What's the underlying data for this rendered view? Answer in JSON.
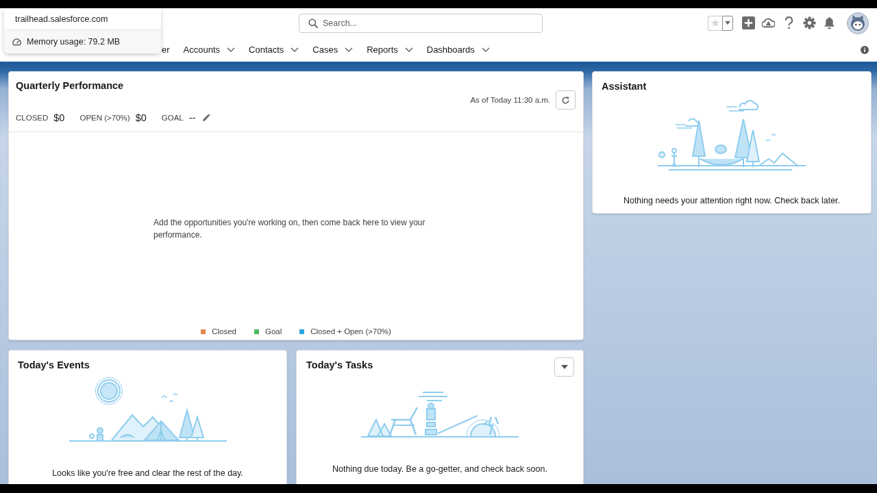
{
  "tooltip": {
    "site": "trailhead.salesforce.com",
    "memory": "Memory usage: 79.2 MB"
  },
  "header": {
    "search": {
      "placeholder": "Search..."
    }
  },
  "nav": {
    "items": [
      {
        "label": "er",
        "menu": false
      },
      {
        "label": "Accounts",
        "menu": true
      },
      {
        "label": "Contacts",
        "menu": true
      },
      {
        "label": "Cases",
        "menu": true
      },
      {
        "label": "Reports",
        "menu": true
      },
      {
        "label": "Dashboards",
        "menu": true
      }
    ]
  },
  "quarterly_performance": {
    "title": "Quarterly Performance",
    "as_of": "As of Today 11:30 a.m.",
    "metrics": [
      {
        "label": "CLOSED",
        "value": "$0",
        "editable": false
      },
      {
        "label": "OPEN (>70%)",
        "value": "$0",
        "editable": false
      },
      {
        "label": "GOAL",
        "value": "--",
        "editable": true
      }
    ],
    "message": "Add the opportunities you're working on, then come back here to view your performance.",
    "legend": [
      {
        "label": "Closed",
        "color": "#e8874a"
      },
      {
        "label": "Goal",
        "color": "#4cbb5c"
      },
      {
        "label": "Closed + Open (>70%)",
        "color": "#2aa6dd"
      }
    ]
  },
  "assistant": {
    "title": "Assistant",
    "message": "Nothing needs your attention right now. Check back later."
  },
  "events": {
    "title": "Today's Events",
    "message": "Looks like you're free and clear the rest of the day."
  },
  "tasks": {
    "title": "Today's Tasks",
    "message": "Nothing due today. Be a go-getter, and check back soon."
  }
}
